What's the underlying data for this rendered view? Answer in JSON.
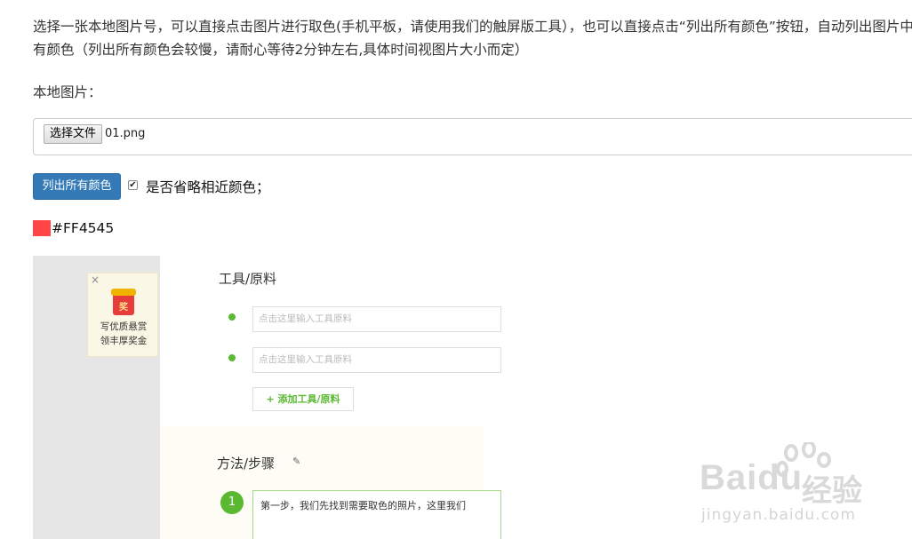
{
  "intro": {
    "line1": "选择一张本地图片号，可以直接点击图片进行取色(手机平板，请使用我们的触屏版工具），也可以直接点击“列出所有颜色”按钮，自动列出图片中所",
    "line2": "有颜色（列出所有颜色会较慢，请耐心等待2分钟左右,具体时间视图片大小而定）"
  },
  "local_image_label": "本地图片：",
  "file_input": {
    "button_label": "选择文件",
    "file_name": "01.png"
  },
  "list_colors_button": "列出所有颜色",
  "ignore_similar": {
    "checked": true,
    "check_glyph": "✔",
    "label": "是否省略相近颜色；"
  },
  "picked_color": {
    "hex": "#FF4545",
    "swatch_color": "#FF4545"
  },
  "screenshot": {
    "ad": {
      "close": "×",
      "icon_char": "奖",
      "line1": "写优质悬赏",
      "line2": "领丰厚奖金"
    },
    "tools_title": "工具/原料",
    "tool_placeholder_1": "点击这里输入工具原料",
    "tool_placeholder_2": "点击这里输入工具原料",
    "add_tool_button": "+ 添加工具/原料",
    "method_title": "方法/步骤",
    "pencil_icon": "✎",
    "step_number": "1",
    "step_text": "第一步，我们先找到需要取色的照片，这里我们"
  },
  "watermark": {
    "brand": "Bai",
    "brand_tail": "du",
    "cn": "经验",
    "url": "jingyan.baidu.com"
  },
  "colors": {
    "primary_button": "#337ab7",
    "green": "#5ab832"
  }
}
